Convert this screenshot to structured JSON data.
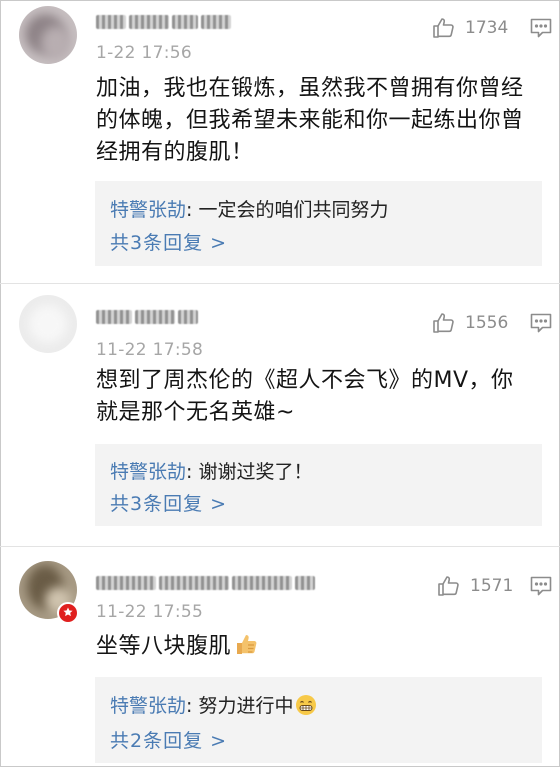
{
  "comments": [
    {
      "timestamp": "1-22 17:56",
      "likes": "1734",
      "text": "加油，我也在锻炼，虽然我不曾拥有你曾经的体魄，但我希望未来能和你一起练出你曾经拥有的腹肌！",
      "reply_author": "特警张劼",
      "reply_text": ": 一定会的咱们共同努力",
      "reply_more": "共3条回复 >",
      "avatar_color": "#9a8e92"
    },
    {
      "timestamp": "11-22 17:58",
      "likes": "1556",
      "text": "想到了周杰伦的《超人不会飞》的MV，你就是那个无名英雄~",
      "reply_author": "特警张劼",
      "reply_text": ": 谢谢过奖了！",
      "reply_more": "共3条回复 >",
      "avatar_color": "#e4e4e4"
    },
    {
      "timestamp": "11-22 17:55",
      "likes": "1571",
      "text": "坐等八块腹肌",
      "reply_author": "特警张劼",
      "reply_text": ": 努力进行中",
      "reply_more": "共2条回复 >",
      "avatar_color": "#7d6f5a"
    }
  ],
  "icons": {
    "like": "thumbs-up-icon",
    "reply": "comment-bubble-icon",
    "badge": "red-verified-badge",
    "thumbs_emoji": "thumbs-up-emoji",
    "grin_emoji": "grinning-face-emoji"
  },
  "colors": {
    "link": "#4a7bb3",
    "reply_bg": "#f3f3f3",
    "muted": "#8c8c8c",
    "badge": "#e0201f"
  }
}
